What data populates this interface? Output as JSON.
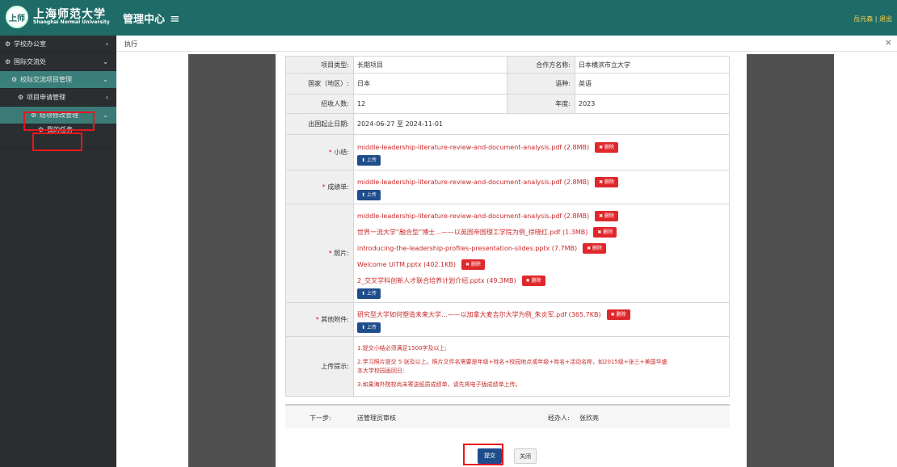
{
  "header": {
    "logo_seal": "上师",
    "logo_cn": "上海师范大学",
    "logo_en": "Shanghai Normal University",
    "title": "管理中心",
    "menu_icon": "≡",
    "user_name": "岳元森",
    "separator": "|",
    "logout": "退出"
  },
  "sidebar": {
    "items": [
      {
        "label": "学校办公室",
        "arrow": "‹"
      },
      {
        "label": "国际交流处",
        "arrow": "⌄"
      },
      {
        "label": "校际交流项目管理",
        "arrow": "⌄"
      },
      {
        "label": "项目申请管理",
        "arrow": "‹"
      },
      {
        "label": "结项修改管理",
        "arrow": "⌄"
      },
      {
        "label": "我的任务"
      }
    ]
  },
  "tabs": {
    "active": "执行",
    "close": "×"
  },
  "form": {
    "project_type_label": "项目类型:",
    "project_type": "长期项目",
    "partner_label": "合作方名称:",
    "partner": "日本横滨市立大学",
    "country_label": "国家（地区）:",
    "country": "日本",
    "language_label": "语种:",
    "language": "英语",
    "quota_label": "招收人数:",
    "quota": "12",
    "year_label": "年度:",
    "year": "2023",
    "dates_label": "出国起止日期:",
    "dates": "2024-06-27 至 2024-11-01",
    "required_mark": "*",
    "summary_label": "小结:",
    "summary_files": [
      "middle-leadership-literature-review-and-document-analysis.pdf (2.8MB)"
    ],
    "transcript_label": "成绩单:",
    "transcript_files": [
      "middle-leadership-literature-review-and-document-analysis.pdf (2.8MB)"
    ],
    "photos_label": "照片:",
    "photo_files": [
      "middle-leadership-literature-review-and-document-analysis.pdf (2.8MB)",
      "世界一流大学“融合型”博士...——以英国帝国理工学院为例_徐晓红.pdf (1.3MB)",
      "introducing-the-leadership-profiles-presentation-slides.pptx (7.7MB)",
      "Welcome UiTM.pptx (402.1KB)",
      "2_交叉学科创新人才联合培养计划介绍.pptx (49.3MB)"
    ],
    "other_label": "其他附件:",
    "other_files": [
      "研究型大学如何塑造未来大学...——以加拿大麦吉尔大学为例_朱炎军.pdf (365.7KB)"
    ],
    "delete_label": "✖ 删除",
    "upload_label": "⬆ 上传",
    "hint_label": "上传提示:",
    "hints": [
      "1.提交小结必须满足1500字及以上;",
      "2.学习照片提交 5 张及以上。照片文件名需要是年级+姓名+校园地点或年级+姓名+活动名称，如2015级+张三+美国华盛",
      "本大学校园画回日;",
      "3.如果海外院校尚未寄送纸质成绩单，请先将电子版成绩单上传。"
    ]
  },
  "next": {
    "label": "下一步:",
    "value": "送管理员审核",
    "handler_label": "经办人:",
    "handler": "张欣亮"
  },
  "buttons": {
    "submit": "提交",
    "close": "关闭"
  },
  "colors": {
    "header": "#1f6b67",
    "sidebar": "#2b2e31",
    "highlight": "#e8161f",
    "primary_button": "#1f4d8c",
    "delete_button": "#e0282c",
    "file_link": "#c9292a"
  }
}
